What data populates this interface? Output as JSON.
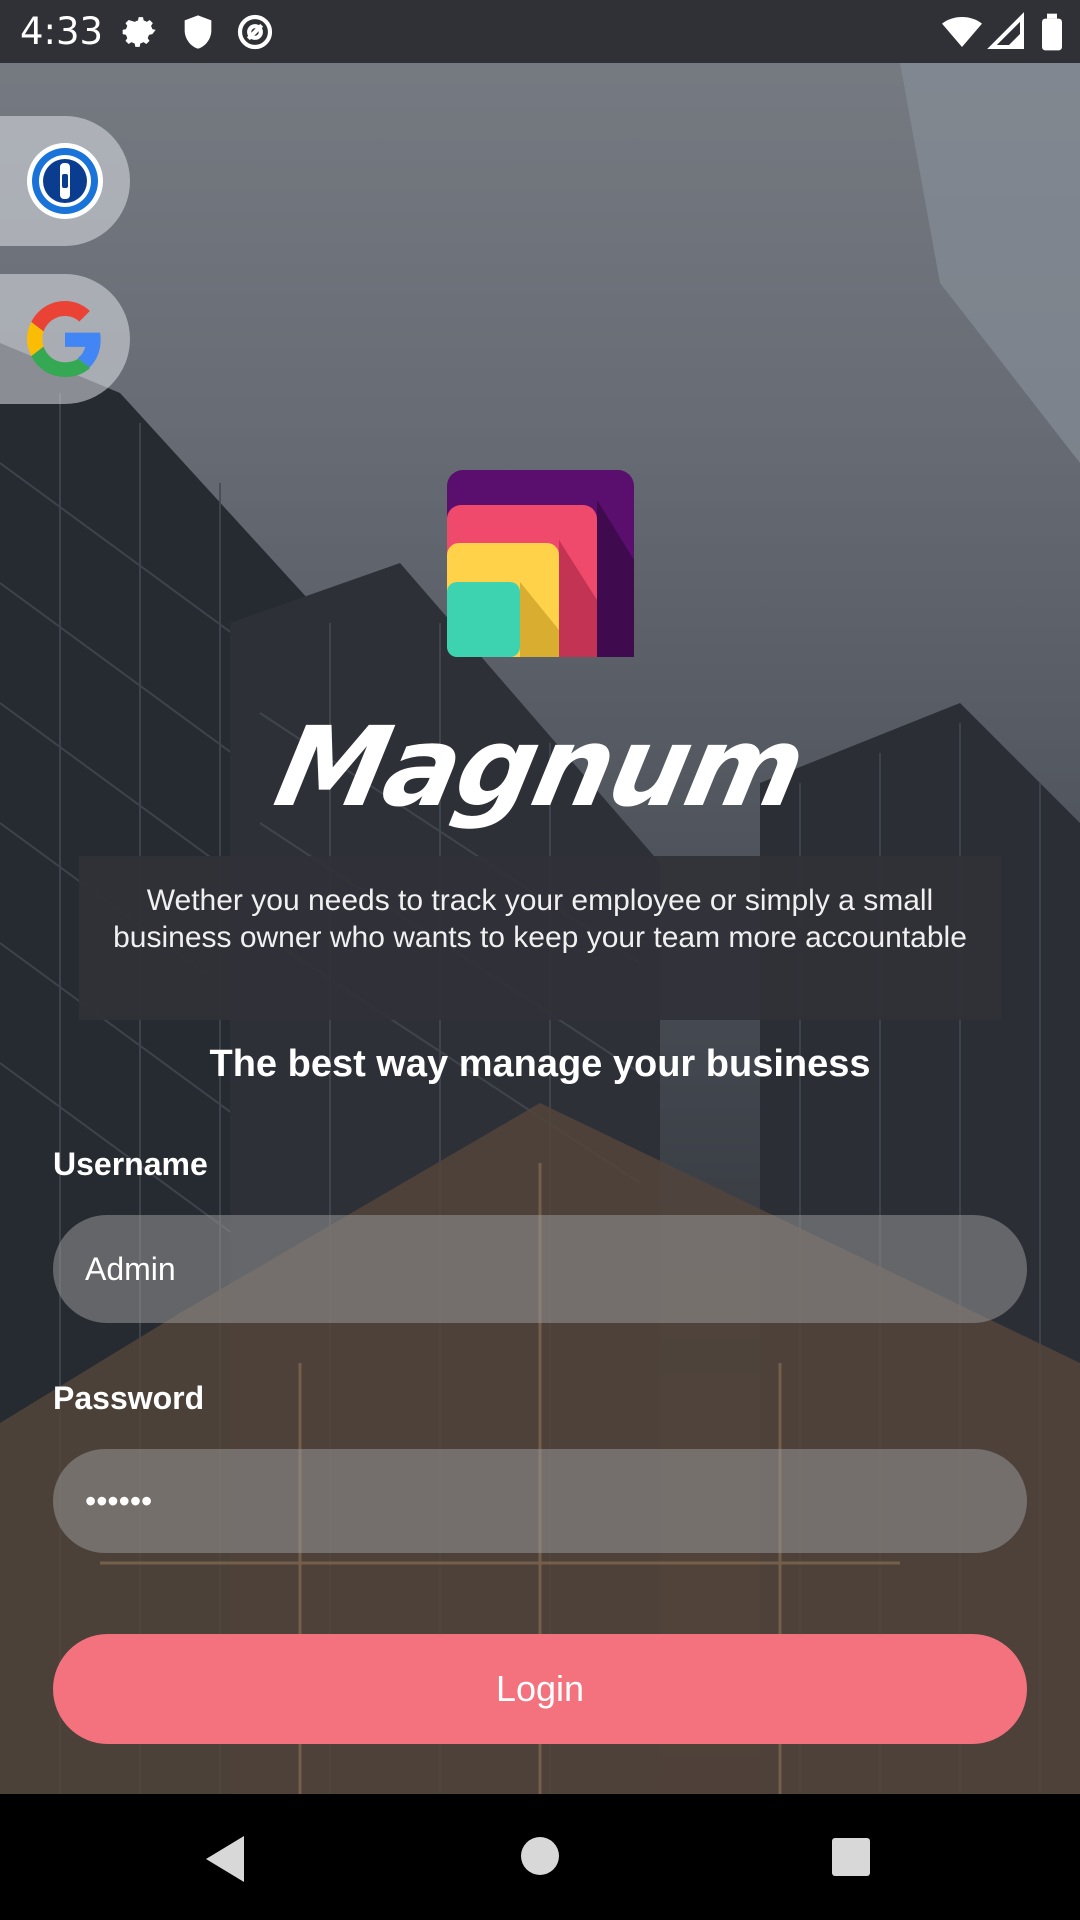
{
  "status_bar": {
    "time": "4:33",
    "left_icons": [
      "gear-icon",
      "shield-icon",
      "at-sign-icon"
    ],
    "right_icons": [
      "wifi-icon",
      "signal-icon",
      "battery-icon"
    ]
  },
  "side_buttons": [
    {
      "name": "password-manager-icon"
    },
    {
      "name": "google-icon"
    }
  ],
  "logo": {
    "colors": [
      "#5a0f6e",
      "#ef4a6c",
      "#ffd24a",
      "#3dd3b0"
    ]
  },
  "brand_name": "Magnum",
  "description": "Wether you needs to track your employee or simply a small business owner who wants to keep your team more accountable",
  "tagline": "The best way manage your business",
  "form": {
    "username_label": "Username",
    "username_value": "Admin",
    "password_label": "Password",
    "password_value": "••••••",
    "login_label": "Login"
  },
  "colors": {
    "login_button": "#f3727e",
    "status_bar": "#2f3136"
  },
  "nav_bar": {
    "icons": [
      "back-icon",
      "home-icon",
      "recents-icon"
    ]
  }
}
